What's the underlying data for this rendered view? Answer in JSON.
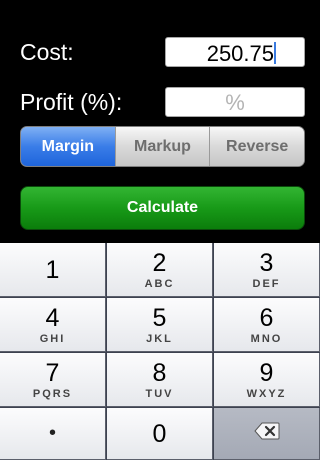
{
  "form": {
    "cost_label": "Cost:",
    "cost_value": "250.75",
    "profit_label": "Profit (%):",
    "profit_placeholder": "%"
  },
  "mode": {
    "options": [
      "Margin",
      "Markup",
      "Reverse"
    ],
    "selected": "Margin"
  },
  "calculate_label": "Calculate",
  "keypad": {
    "keys": [
      {
        "num": "1",
        "letters": ""
      },
      {
        "num": "2",
        "letters": "ABC"
      },
      {
        "num": "3",
        "letters": "DEF"
      },
      {
        "num": "4",
        "letters": "GHI"
      },
      {
        "num": "5",
        "letters": "JKL"
      },
      {
        "num": "6",
        "letters": "MNO"
      },
      {
        "num": "7",
        "letters": "PQRS"
      },
      {
        "num": "8",
        "letters": "TUV"
      },
      {
        "num": "9",
        "letters": "WXYZ"
      }
    ],
    "decimal_key": "•",
    "zero_key": "0",
    "delete_icon": "backspace-icon"
  },
  "colors": {
    "accent_blue": "#3a7de8",
    "calculate_green": "#189a18",
    "background": "#000000"
  }
}
